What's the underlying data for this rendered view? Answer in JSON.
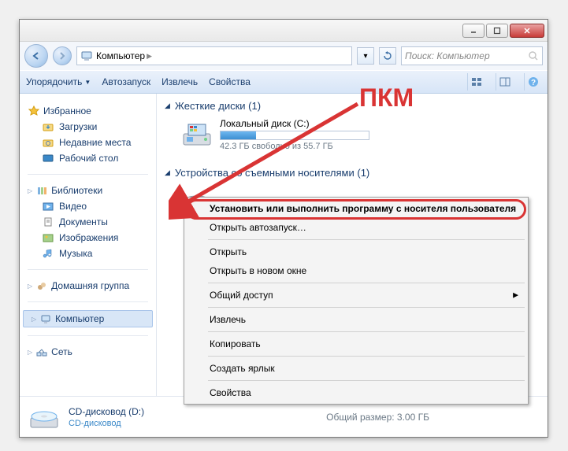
{
  "annotation": {
    "label": "ПКМ"
  },
  "path": {
    "root_label": "Компьютер"
  },
  "search": {
    "placeholder": "Поиск: Компьютер"
  },
  "toolbar": {
    "organize": "Упорядочить",
    "autoplay": "Автозапуск",
    "eject": "Извлечь",
    "properties": "Свойства"
  },
  "sidebar": {
    "favorites": {
      "label": "Избранное",
      "items": [
        "Загрузки",
        "Недавние места",
        "Рабочий стол"
      ]
    },
    "libraries": {
      "label": "Библиотеки",
      "items": [
        "Видео",
        "Документы",
        "Изображения",
        "Музыка"
      ]
    },
    "homegroup": {
      "label": "Домашняя группа"
    },
    "computer": {
      "label": "Компьютер"
    },
    "network": {
      "label": "Сеть"
    }
  },
  "sections": {
    "hdd": {
      "title": "Жесткие диски (1)",
      "drive_name": "Локальный диск (C:)",
      "free_text": "42.3 ГБ свободно из 55.7 ГБ",
      "fill_pct": 24
    },
    "removable": {
      "title": "Устройства со съемными носителями (1)",
      "drive_name": "CD-дисковод (D:)"
    }
  },
  "context_menu": {
    "items": [
      "Установить или выполнить программу с носителя пользователя",
      "Открыть автозапуск…",
      "Открыть",
      "Открыть в новом окне",
      "Общий доступ",
      "Извлечь",
      "Копировать",
      "Создать ярлык",
      "Свойства"
    ]
  },
  "details": {
    "name": "CD-дисковод (D:)",
    "type": "CD-дисковод",
    "total": "Общий размер: 3.00 ГБ"
  }
}
